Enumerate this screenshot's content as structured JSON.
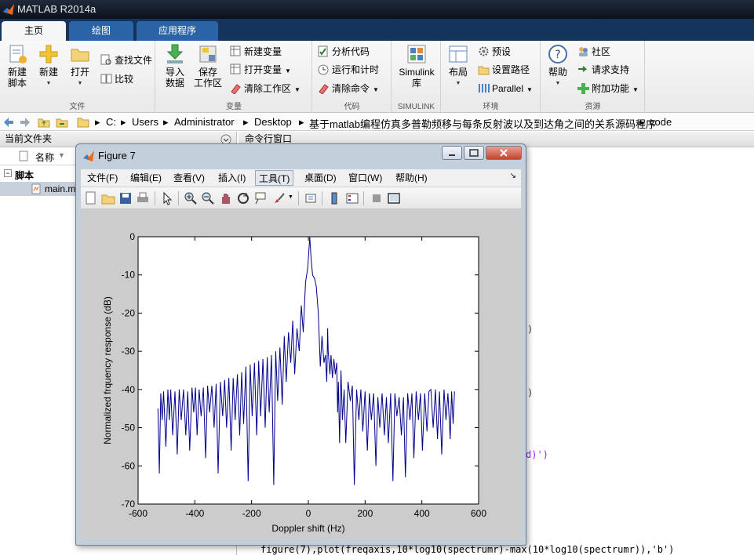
{
  "window": {
    "title": "MATLAB R2014a"
  },
  "tabs": [
    {
      "label": "主页",
      "active": true
    },
    {
      "label": "绘图",
      "active": false
    },
    {
      "label": "应用程序",
      "active": false
    }
  ],
  "ribbon": {
    "file_section": {
      "label": "文件",
      "new_script": "新建\n脚本",
      "new": "新建",
      "open": "打开",
      "find_files": "查找文件",
      "compare": "比较"
    },
    "variable_section": {
      "label": "变量",
      "import_data": "导入\n数据",
      "save_workspace": "保存\n工作区",
      "new_variable": "新建变量",
      "open_variable": "打开变量",
      "clear_workspace": "清除工作区"
    },
    "code_section": {
      "label": "代码",
      "analyze_code": "分析代码",
      "run_and_time": "运行和计时",
      "clear_commands": "清除命令"
    },
    "simulink_section": {
      "label": "SIMULINK",
      "simulink_library": "Simulink\n库"
    },
    "environment_section": {
      "label": "环境",
      "layout": "布局",
      "preferences": "预设",
      "set_path": "设置路径",
      "parallel": "Parallel"
    },
    "resources_section": {
      "label": "资源",
      "help": "帮助",
      "community": "社区",
      "request_support": "请求支持",
      "add_ons": "附加功能"
    }
  },
  "address_bar": {
    "path": [
      "C:",
      "Users",
      "Administrator",
      "Desktop",
      "基于matlab编程仿真多普勒频移与每条反射波以及到达角之间的关系源码程序",
      "code"
    ]
  },
  "current_folder": {
    "title": "当前文件夹",
    "column_name": "名称",
    "group": "脚本",
    "file": "main.m"
  },
  "command_window": {
    "title": "命令行窗口",
    "fragments": [
      ")",
      ")",
      "d)')"
    ],
    "last_line": "figure(7),plot(freqaxis,10*log10(spectrumr)-max(10*log10(spectrumr)),'b')"
  },
  "figure": {
    "title": "Figure 7",
    "menu": [
      "文件(F)",
      "编辑(E)",
      "查看(V)",
      "插入(I)",
      "工具(T)",
      "桌面(D)",
      "窗口(W)",
      "帮助(H)"
    ],
    "selected_menu": "工具(T)",
    "toolbar_icons": [
      "new-figure-icon",
      "open-file-icon",
      "save-icon",
      "print-icon",
      "pointer-icon",
      "zoom-in-icon",
      "zoom-out-icon",
      "pan-icon",
      "rotate-icon",
      "data-cursor-icon",
      "brush-icon",
      "link-icon",
      "colorbar-icon",
      "legend-icon",
      "hide-tools-icon",
      "dock-icon"
    ]
  },
  "chart_data": {
    "type": "line",
    "title": "",
    "xlabel": "Doppler shift (Hz)",
    "ylabel": "Normalized frquency response (dB)",
    "xlim": [
      -600,
      600
    ],
    "ylim": [
      -70,
      0
    ],
    "xticks": [
      -600,
      -400,
      -200,
      0,
      200,
      400,
      600
    ],
    "yticks": [
      0,
      -10,
      -20,
      -30,
      -40,
      -50,
      -60,
      -70
    ],
    "grid": false,
    "color": "#00008b",
    "series": [
      {
        "x": [
          -530,
          -525,
          -520,
          -515,
          -510,
          -502,
          -495,
          -490,
          -485,
          -478,
          -470,
          -462,
          -455,
          -448,
          -440,
          -432,
          -425,
          -418,
          -410,
          -404,
          -398,
          -392,
          -385,
          -378,
          -370,
          -362,
          -355,
          -348,
          -340,
          -332,
          -325,
          -318,
          -310,
          -302,
          -295,
          -288,
          -280,
          -272,
          -265,
          -258,
          -250,
          -242,
          -235,
          -228,
          -220,
          -212,
          -205,
          -198,
          -190,
          -182,
          -175,
          -168,
          -160,
          -152,
          -145,
          -138,
          -130,
          -122,
          -115,
          -108,
          -100,
          -92,
          -85,
          -78,
          -70,
          -62,
          -55,
          -48,
          -40,
          -32,
          -25,
          -18,
          -10,
          -2,
          5,
          10,
          15,
          22,
          28,
          35,
          42,
          48,
          55,
          60,
          65,
          68,
          70,
          73,
          76,
          80,
          85,
          90,
          95,
          100,
          103,
          106,
          110,
          115,
          120,
          126,
          132,
          140,
          148,
          155,
          162,
          170,
          178,
          185,
          192,
          200,
          208,
          215,
          222,
          230,
          238,
          245,
          252,
          260,
          268,
          275,
          282,
          290,
          298,
          305,
          312,
          320,
          328,
          335,
          342,
          350,
          358,
          365,
          372,
          380,
          388,
          395,
          402,
          410,
          418,
          425,
          432,
          440,
          448,
          455,
          462,
          470,
          478,
          485,
          492,
          500,
          505,
          510,
          515
        ],
        "y": [
          -45,
          -62,
          -41,
          -48,
          -40.5,
          -55,
          -40,
          -48,
          -40,
          -52,
          -40.5,
          -57,
          -40,
          -48,
          -40,
          -52,
          -40.5,
          -56,
          -39.5,
          -46,
          -39.5,
          -52,
          -40,
          -47,
          -39.5,
          -58,
          -39,
          -46,
          -39,
          -50,
          -38.5,
          -62,
          -38,
          -47,
          -37.5,
          -50,
          -37,
          -56,
          -37,
          -48,
          -36,
          -52,
          -35.5,
          -49,
          -34,
          -64,
          -33.5,
          -47,
          -33,
          -52,
          -32.5,
          -47,
          -32,
          -50,
          -31.5,
          -46,
          -31,
          -65,
          -30,
          -43,
          -29,
          -44,
          -26,
          -38,
          -25,
          -33,
          -22,
          -36,
          -24,
          -30,
          -18,
          -25,
          -12,
          -8,
          0,
          -6,
          -10,
          -11,
          -13,
          -20,
          -34,
          -26,
          -33,
          -31,
          -38,
          -24,
          -30,
          -33,
          -36,
          -31,
          -37,
          -32,
          -36,
          -33,
          -46,
          -38,
          -54,
          -35,
          -48,
          -40,
          -54,
          -38,
          -43,
          -39,
          -65,
          -40,
          -48,
          -40,
          -51,
          -40.5,
          -56,
          -41,
          -48,
          -41,
          -60,
          -42,
          -50,
          -41,
          -52,
          -42,
          -54,
          -41,
          -64,
          -41,
          -47,
          -42,
          -52,
          -42,
          -63,
          -41,
          -48,
          -41,
          -58,
          -40.5,
          -48,
          -41,
          -56,
          -41,
          -51,
          -40.5,
          -40,
          -50,
          -40,
          -53,
          -40.5,
          -57,
          -40,
          -48,
          -41,
          -53,
          -40.5,
          -49,
          -40.5
        ]
      }
    ]
  }
}
